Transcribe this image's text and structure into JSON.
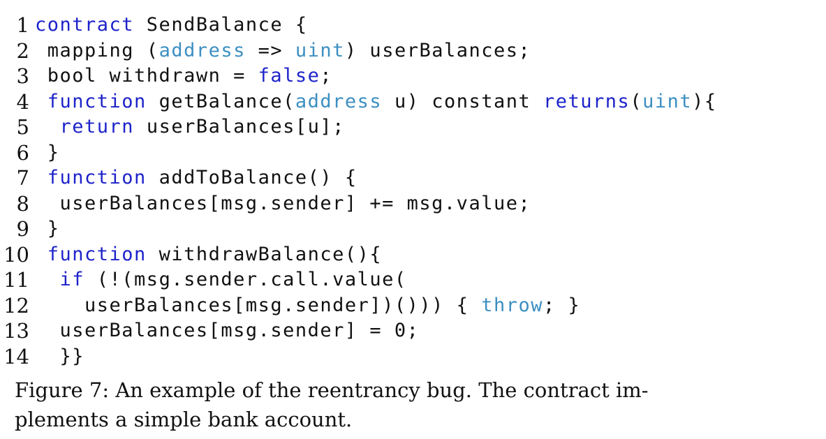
{
  "code_lines": [
    {
      "num": "1",
      "tokens": [
        {
          "t": "contract",
          "c": "k1"
        },
        {
          "t": " SendBalance {",
          "c": ""
        }
      ]
    },
    {
      "num": "2",
      "tokens": [
        {
          "t": " mapping (",
          "c": ""
        },
        {
          "t": "address",
          "c": "k2"
        },
        {
          "t": " => ",
          "c": ""
        },
        {
          "t": "uint",
          "c": "k2"
        },
        {
          "t": ") userBalances;",
          "c": ""
        }
      ]
    },
    {
      "num": "3",
      "tokens": [
        {
          "t": " bool withdrawn = ",
          "c": ""
        },
        {
          "t": "false",
          "c": "k1"
        },
        {
          "t": ";",
          "c": ""
        }
      ]
    },
    {
      "num": "4",
      "tokens": [
        {
          "t": " ",
          "c": ""
        },
        {
          "t": "function",
          "c": "k1"
        },
        {
          "t": " getBalance(",
          "c": ""
        },
        {
          "t": "address",
          "c": "k2"
        },
        {
          "t": " u) constant ",
          "c": ""
        },
        {
          "t": "returns",
          "c": "k1"
        },
        {
          "t": "(",
          "c": ""
        },
        {
          "t": "uint",
          "c": "k2"
        },
        {
          "t": "){",
          "c": ""
        }
      ]
    },
    {
      "num": "5",
      "tokens": [
        {
          "t": "  ",
          "c": ""
        },
        {
          "t": "return",
          "c": "k1"
        },
        {
          "t": " userBalances[u];",
          "c": ""
        }
      ]
    },
    {
      "num": "6",
      "tokens": [
        {
          "t": " }",
          "c": ""
        }
      ]
    },
    {
      "num": "7",
      "tokens": [
        {
          "t": " ",
          "c": ""
        },
        {
          "t": "function",
          "c": "k1"
        },
        {
          "t": " addToBalance() {",
          "c": ""
        }
      ]
    },
    {
      "num": "8",
      "tokens": [
        {
          "t": "  userBalances[msg.sender] += msg.value;",
          "c": ""
        }
      ]
    },
    {
      "num": "9",
      "tokens": [
        {
          "t": " }",
          "c": ""
        }
      ]
    },
    {
      "num": "10",
      "tokens": [
        {
          "t": " ",
          "c": ""
        },
        {
          "t": "function",
          "c": "k1"
        },
        {
          "t": " withdrawBalance(){",
          "c": ""
        }
      ]
    },
    {
      "num": "11",
      "tokens": [
        {
          "t": "  ",
          "c": ""
        },
        {
          "t": "if",
          "c": "k1"
        },
        {
          "t": " (!(msg.sender.call.value(",
          "c": ""
        }
      ]
    },
    {
      "num": "12",
      "tokens": [
        {
          "t": "    userBalances[msg.sender])())) { ",
          "c": ""
        },
        {
          "t": "throw",
          "c": "k2"
        },
        {
          "t": "; }",
          "c": ""
        }
      ]
    },
    {
      "num": "13",
      "tokens": [
        {
          "t": "  userBalances[msg.sender] = 0;",
          "c": ""
        }
      ]
    },
    {
      "num": "14",
      "tokens": [
        {
          "t": "  }}",
          "c": ""
        }
      ]
    }
  ],
  "caption": "Figure 7: An example of the reentrancy bug. The contract im-\nplements a simple bank account.",
  "colors": {
    "keyword_blue": "#1d23c9",
    "type_lightblue": "#3c8fc2",
    "text": "#111111"
  }
}
